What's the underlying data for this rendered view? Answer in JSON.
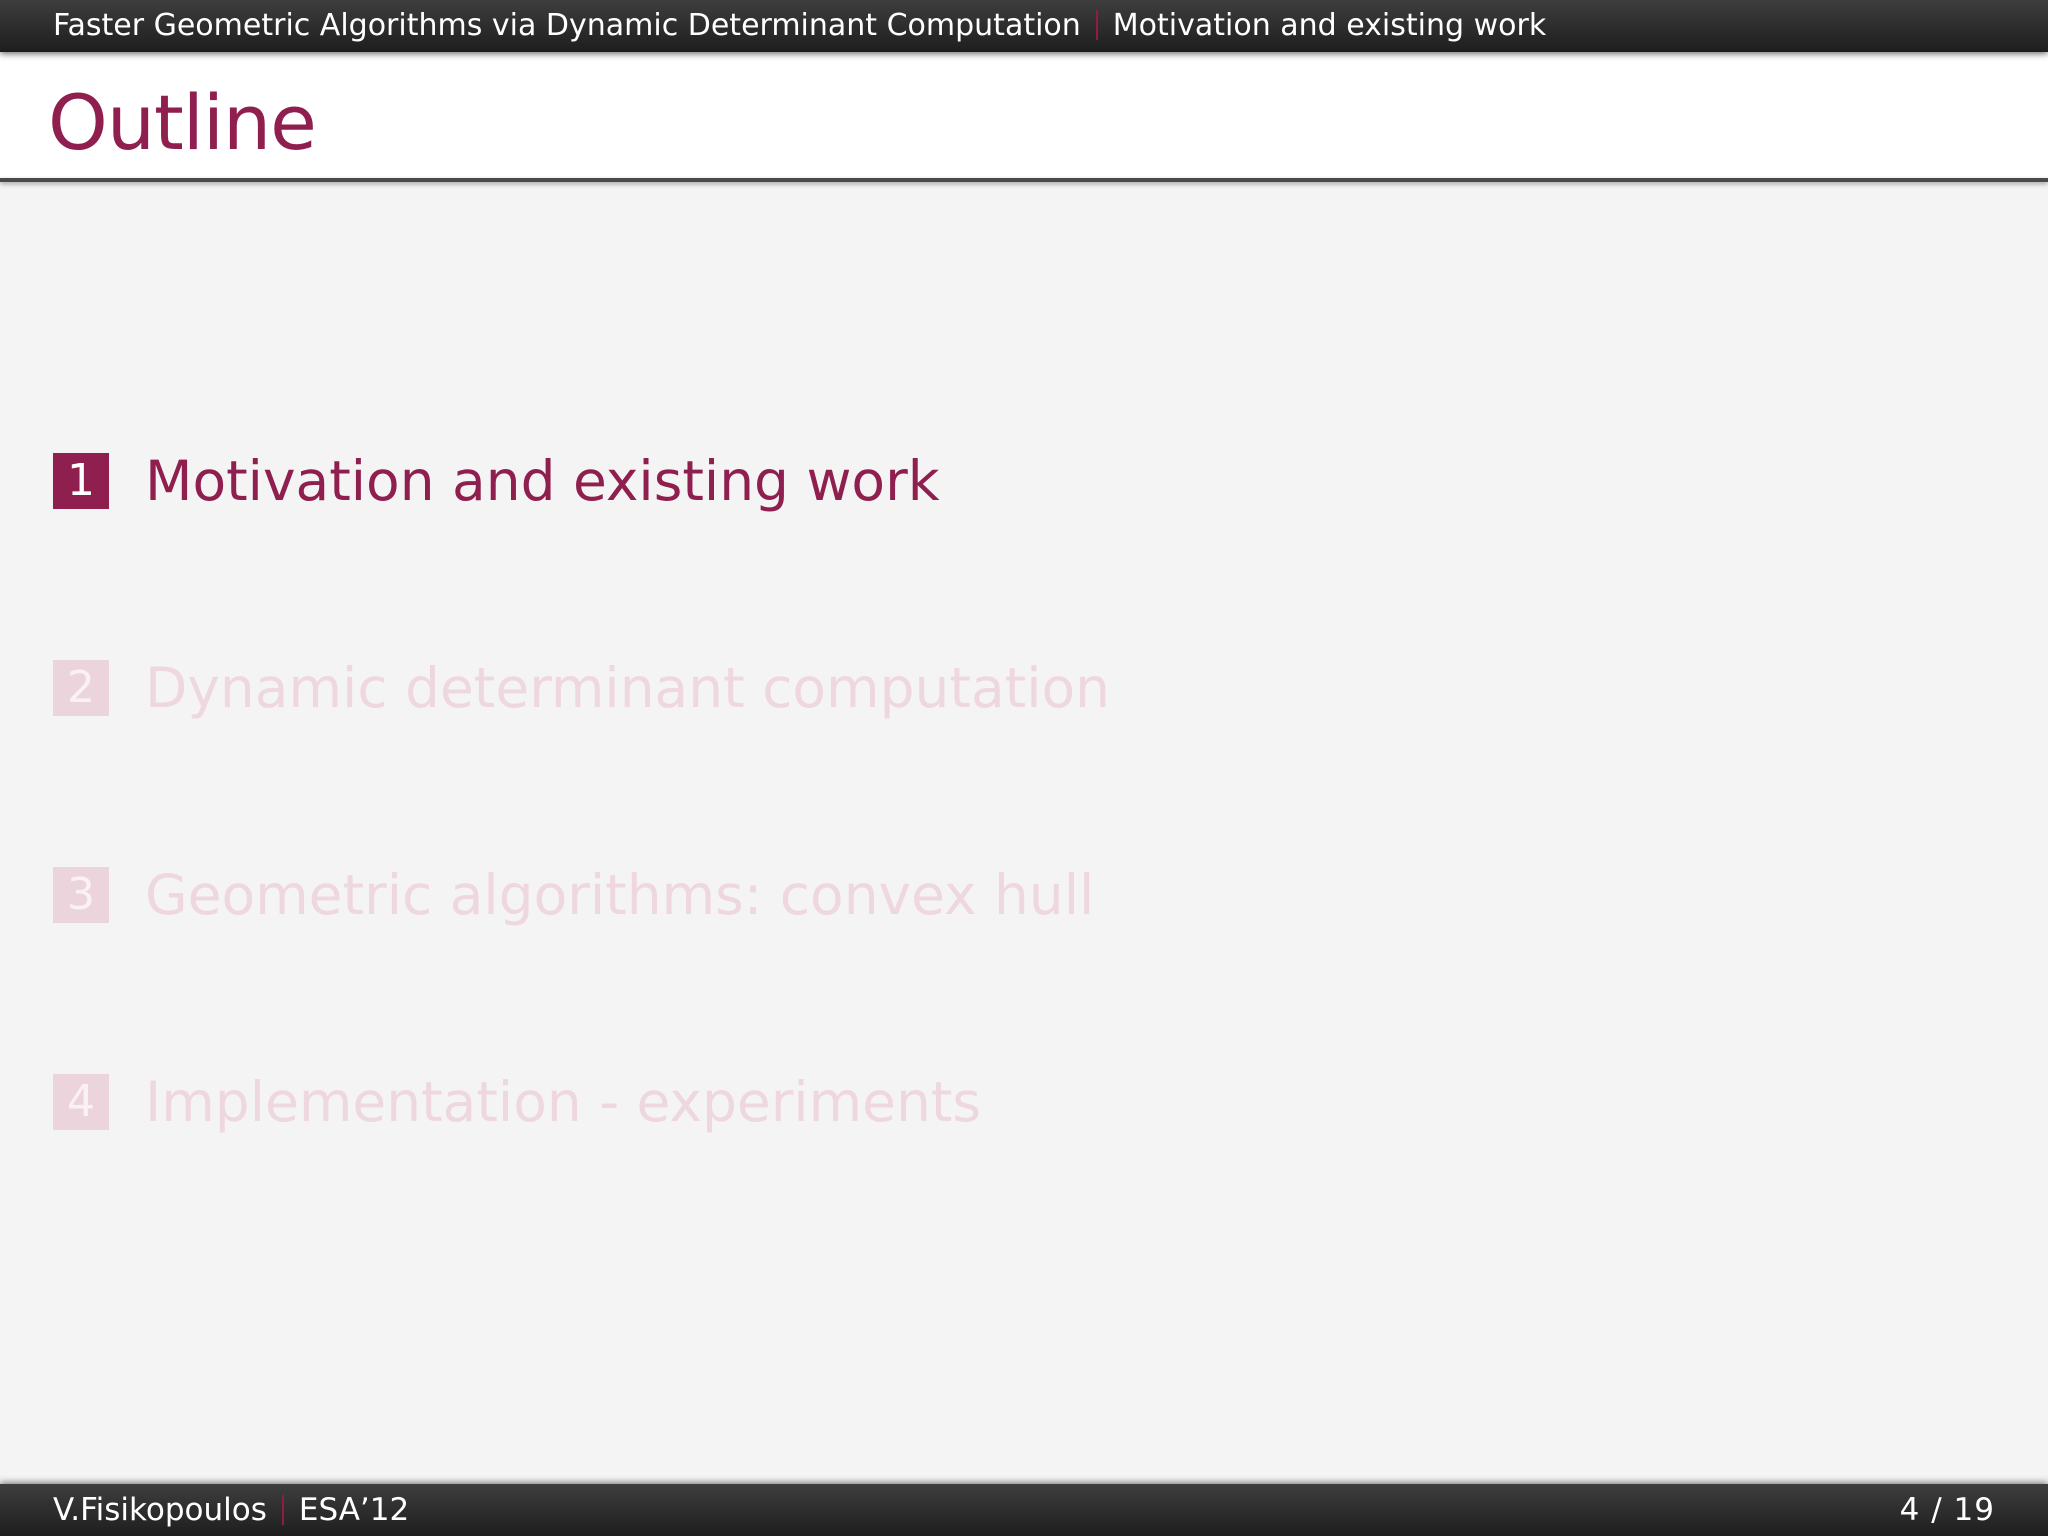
{
  "header": {
    "presentation_title": "Faster Geometric Algorithms via Dynamic Determinant Computation",
    "current_section": "Motivation and existing work"
  },
  "frame": {
    "title": "Outline"
  },
  "outline": {
    "items": [
      {
        "number": "1",
        "label": "Motivation and existing work",
        "state": "active"
      },
      {
        "number": "2",
        "label": "Dynamic determinant computation",
        "state": "shaded"
      },
      {
        "number": "3",
        "label": "Geometric algorithms: convex hull",
        "state": "shaded"
      },
      {
        "number": "4",
        "label": "Implementation - experiments",
        "state": "shaded"
      }
    ]
  },
  "footer": {
    "author": "V.Fisikopoulos",
    "event": "ESA’12",
    "page_current": "4",
    "page_separator": "/",
    "page_total": "19"
  },
  "colors": {
    "accent": "#8e1f4e",
    "shaded_text": "#efd7e0",
    "shaded_box": "#ecd4dc",
    "bar": "#2c2c2c",
    "background": "#f5f4f4"
  }
}
